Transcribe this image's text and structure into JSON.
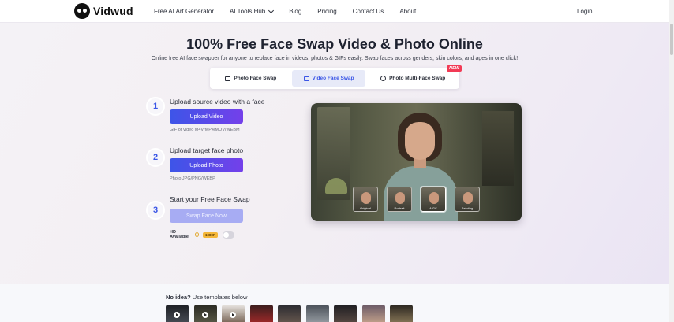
{
  "brand": {
    "name": "Vidwud"
  },
  "nav": {
    "links": [
      "Free AI Art Generator",
      "AI Tools Hub",
      "Blog",
      "Pricing",
      "Contact Us",
      "About"
    ],
    "login": "Login"
  },
  "hero": {
    "title": "100% Free Face Swap Video & Photo Online",
    "subtitle": "Online free AI face swapper for anyone to replace face in videos, photos & GIFs easily. Swap faces across genders, skin colors, and ages in one click!"
  },
  "tabs": {
    "photo": "Photo Face Swap",
    "video": "Video Face Swap",
    "multi": "Photo Multi-Face Swap",
    "new_badge": "NEW"
  },
  "steps": [
    {
      "num": "1",
      "title": "Upload source video with a face",
      "button": "Upload Video",
      "hint": "GIF or video M4V/MP4/MOV/WEBM"
    },
    {
      "num": "2",
      "title": "Upload target face photo",
      "button": "Upload Photo",
      "hint": "Photo JPG/PNG/WEBP"
    },
    {
      "num": "3",
      "title": "Start your Free Face Swap",
      "button": "Swap Face Now",
      "hint": ""
    }
  ],
  "hd": {
    "label": "HD Available",
    "badge": "1080P",
    "enabled": false
  },
  "preview": {
    "thumbnails": [
      "Original",
      "Portrait",
      "AIGC",
      "Painting"
    ],
    "active": "AIGC"
  },
  "templates": {
    "title_bold": "No idea?",
    "title_rest": " Use templates below"
  },
  "colors": {
    "accent": "#3b56e6",
    "button_gradient_end": "#7440ea",
    "badge_new": "#f23a55",
    "hd_badge": "#f4b73a"
  }
}
